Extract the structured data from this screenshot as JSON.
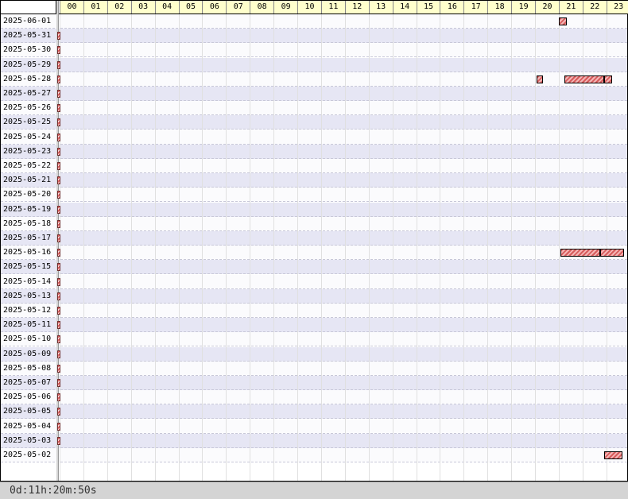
{
  "hours": [
    "00",
    "01",
    "02",
    "03",
    "04",
    "05",
    "06",
    "07",
    "08",
    "09",
    "10",
    "11",
    "12",
    "13",
    "14",
    "15",
    "16",
    "17",
    "18",
    "19",
    "20",
    "21",
    "22",
    "23"
  ],
  "dates": [
    "2025-06-01",
    "2025-05-31",
    "2025-05-30",
    "2025-05-29",
    "2025-05-28",
    "2025-05-27",
    "2025-05-26",
    "2025-05-25",
    "2025-05-24",
    "2025-05-23",
    "2025-05-22",
    "2025-05-21",
    "2025-05-20",
    "2025-05-19",
    "2025-05-18",
    "2025-05-17",
    "2025-05-16",
    "2025-05-15",
    "2025-05-14",
    "2025-05-13",
    "2025-05-12",
    "2025-05-11",
    "2025-05-10",
    "2025-05-09",
    "2025-05-08",
    "2025-05-07",
    "2025-05-06",
    "2025-05-05",
    "2025-05-04",
    "2025-05-03",
    "2025-05-02"
  ],
  "day_marks": [
    "2025-05-31",
    "2025-05-30",
    "2025-05-29",
    "2025-05-28",
    "2025-05-27",
    "2025-05-26",
    "2025-05-25",
    "2025-05-24",
    "2025-05-23",
    "2025-05-22",
    "2025-05-21",
    "2025-05-20",
    "2025-05-19",
    "2025-05-18",
    "2025-05-17",
    "2025-05-16",
    "2025-05-15",
    "2025-05-14",
    "2025-05-13",
    "2025-05-12",
    "2025-05-11",
    "2025-05-10",
    "2025-05-09",
    "2025-05-08",
    "2025-05-07",
    "2025-05-06",
    "2025-05-05",
    "2025-05-04",
    "2025-05-03"
  ],
  "sessions": [
    {
      "date": "2025-06-01",
      "start": "21:00",
      "end": "21:20"
    },
    {
      "date": "2025-05-28",
      "start": "20:05",
      "end": "20:20"
    },
    {
      "date": "2025-05-28",
      "start": "21:15",
      "end": "22:55"
    },
    {
      "date": "2025-05-28",
      "start": "22:55",
      "end": "23:15"
    },
    {
      "date": "2025-05-16",
      "start": "21:05",
      "end": "22:45"
    },
    {
      "date": "2025-05-16",
      "start": "22:45",
      "end": "23:45"
    },
    {
      "date": "2025-05-02",
      "start": "22:55",
      "end": "23:40"
    }
  ],
  "colors": {
    "bar": "#d65c5c",
    "row_odd": "#e6e6f4",
    "header": "#ffffcc"
  },
  "footer": {
    "elapsed": "0d:11h:20m:50s"
  }
}
